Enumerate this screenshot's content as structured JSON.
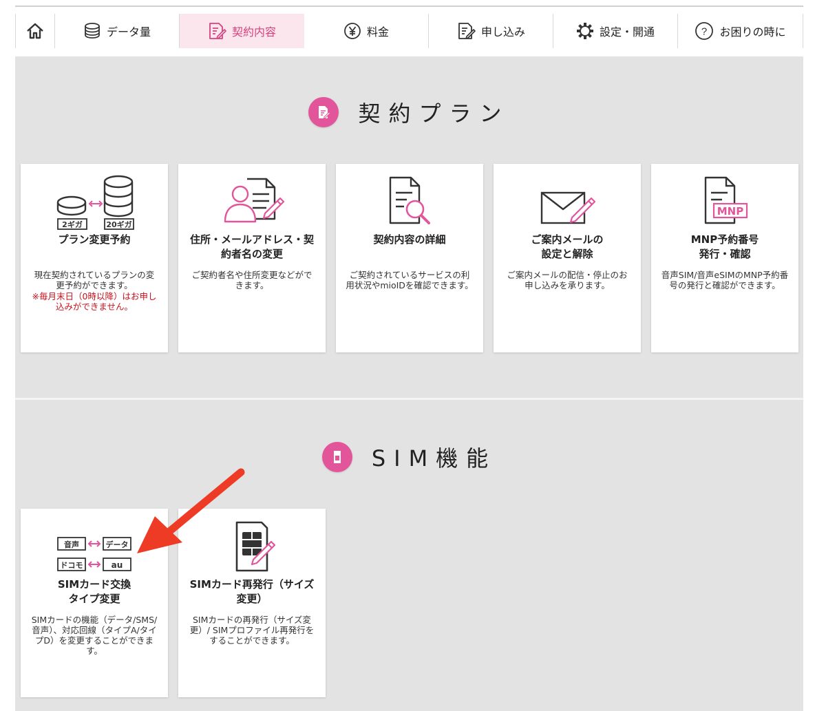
{
  "nav": {
    "items": [
      {
        "label": "",
        "icon": "home-icon"
      },
      {
        "label": "データ量",
        "icon": "data-stack-icon"
      },
      {
        "label": "契約内容",
        "icon": "contract-icon",
        "active": true
      },
      {
        "label": "料金",
        "icon": "yen-icon"
      },
      {
        "label": "申し込み",
        "icon": "application-icon"
      },
      {
        "label": "設定・開通",
        "icon": "gear-icon"
      },
      {
        "label": "お困りの時に",
        "icon": "help-icon"
      }
    ]
  },
  "sections": [
    {
      "title": "契約プラン",
      "icon": "contract-icon",
      "cards": [
        {
          "title": "プラン変更予約",
          "desc": "現在契約されているプランの変更予約ができます。",
          "note": "※毎月末日（0時以降）はお申し込みができません。",
          "icon": "plan-change-icon",
          "labels": [
            "2ギガ",
            "20ギガ"
          ]
        },
        {
          "title": "住所・メールアドレス・契約者名の変更",
          "desc": "ご契約者名や住所変更などができます。",
          "icon": "person-document-icon"
        },
        {
          "title": "契約内容の詳細",
          "desc": "ご契約されているサービスの利用状況やmioIDを確認できます。",
          "icon": "document-search-icon"
        },
        {
          "title": "ご案内メールの\n設定と解除",
          "desc": "ご案内メールの配信・停止のお申し込みを承ります。",
          "icon": "mail-edit-icon"
        },
        {
          "title": "MNP予約番号\n発行・確認",
          "desc": "音声SIM/音声eSIMのMNP予約番号の発行と確認ができます。",
          "icon": "mnp-document-icon",
          "labels": [
            "MNP"
          ]
        }
      ]
    },
    {
      "title": "SIM機能",
      "icon": "sim-icon",
      "cards": [
        {
          "title": "SIMカード交換\nタイプ変更",
          "desc": "SIMカードの機能（データ/SMS/音声）、対応回線（タイプA/タイプD）を変更することができます。",
          "icon": "sim-type-swap-icon",
          "labels": [
            "音声",
            "データ",
            "ドコモ",
            "au"
          ]
        },
        {
          "title": "SIMカード再発行（サイズ変更）",
          "desc": "SIMカードの再発行（サイズ変更）/ SIMプロファイル再発行をすることができます。",
          "icon": "sim-reissue-icon"
        }
      ]
    }
  ],
  "colors": {
    "accent": "#e2559a",
    "active_bg": "#fbe6ee",
    "note": "#c8121b",
    "arrow": "#ee3b25",
    "panel": "#e3e3e3"
  }
}
